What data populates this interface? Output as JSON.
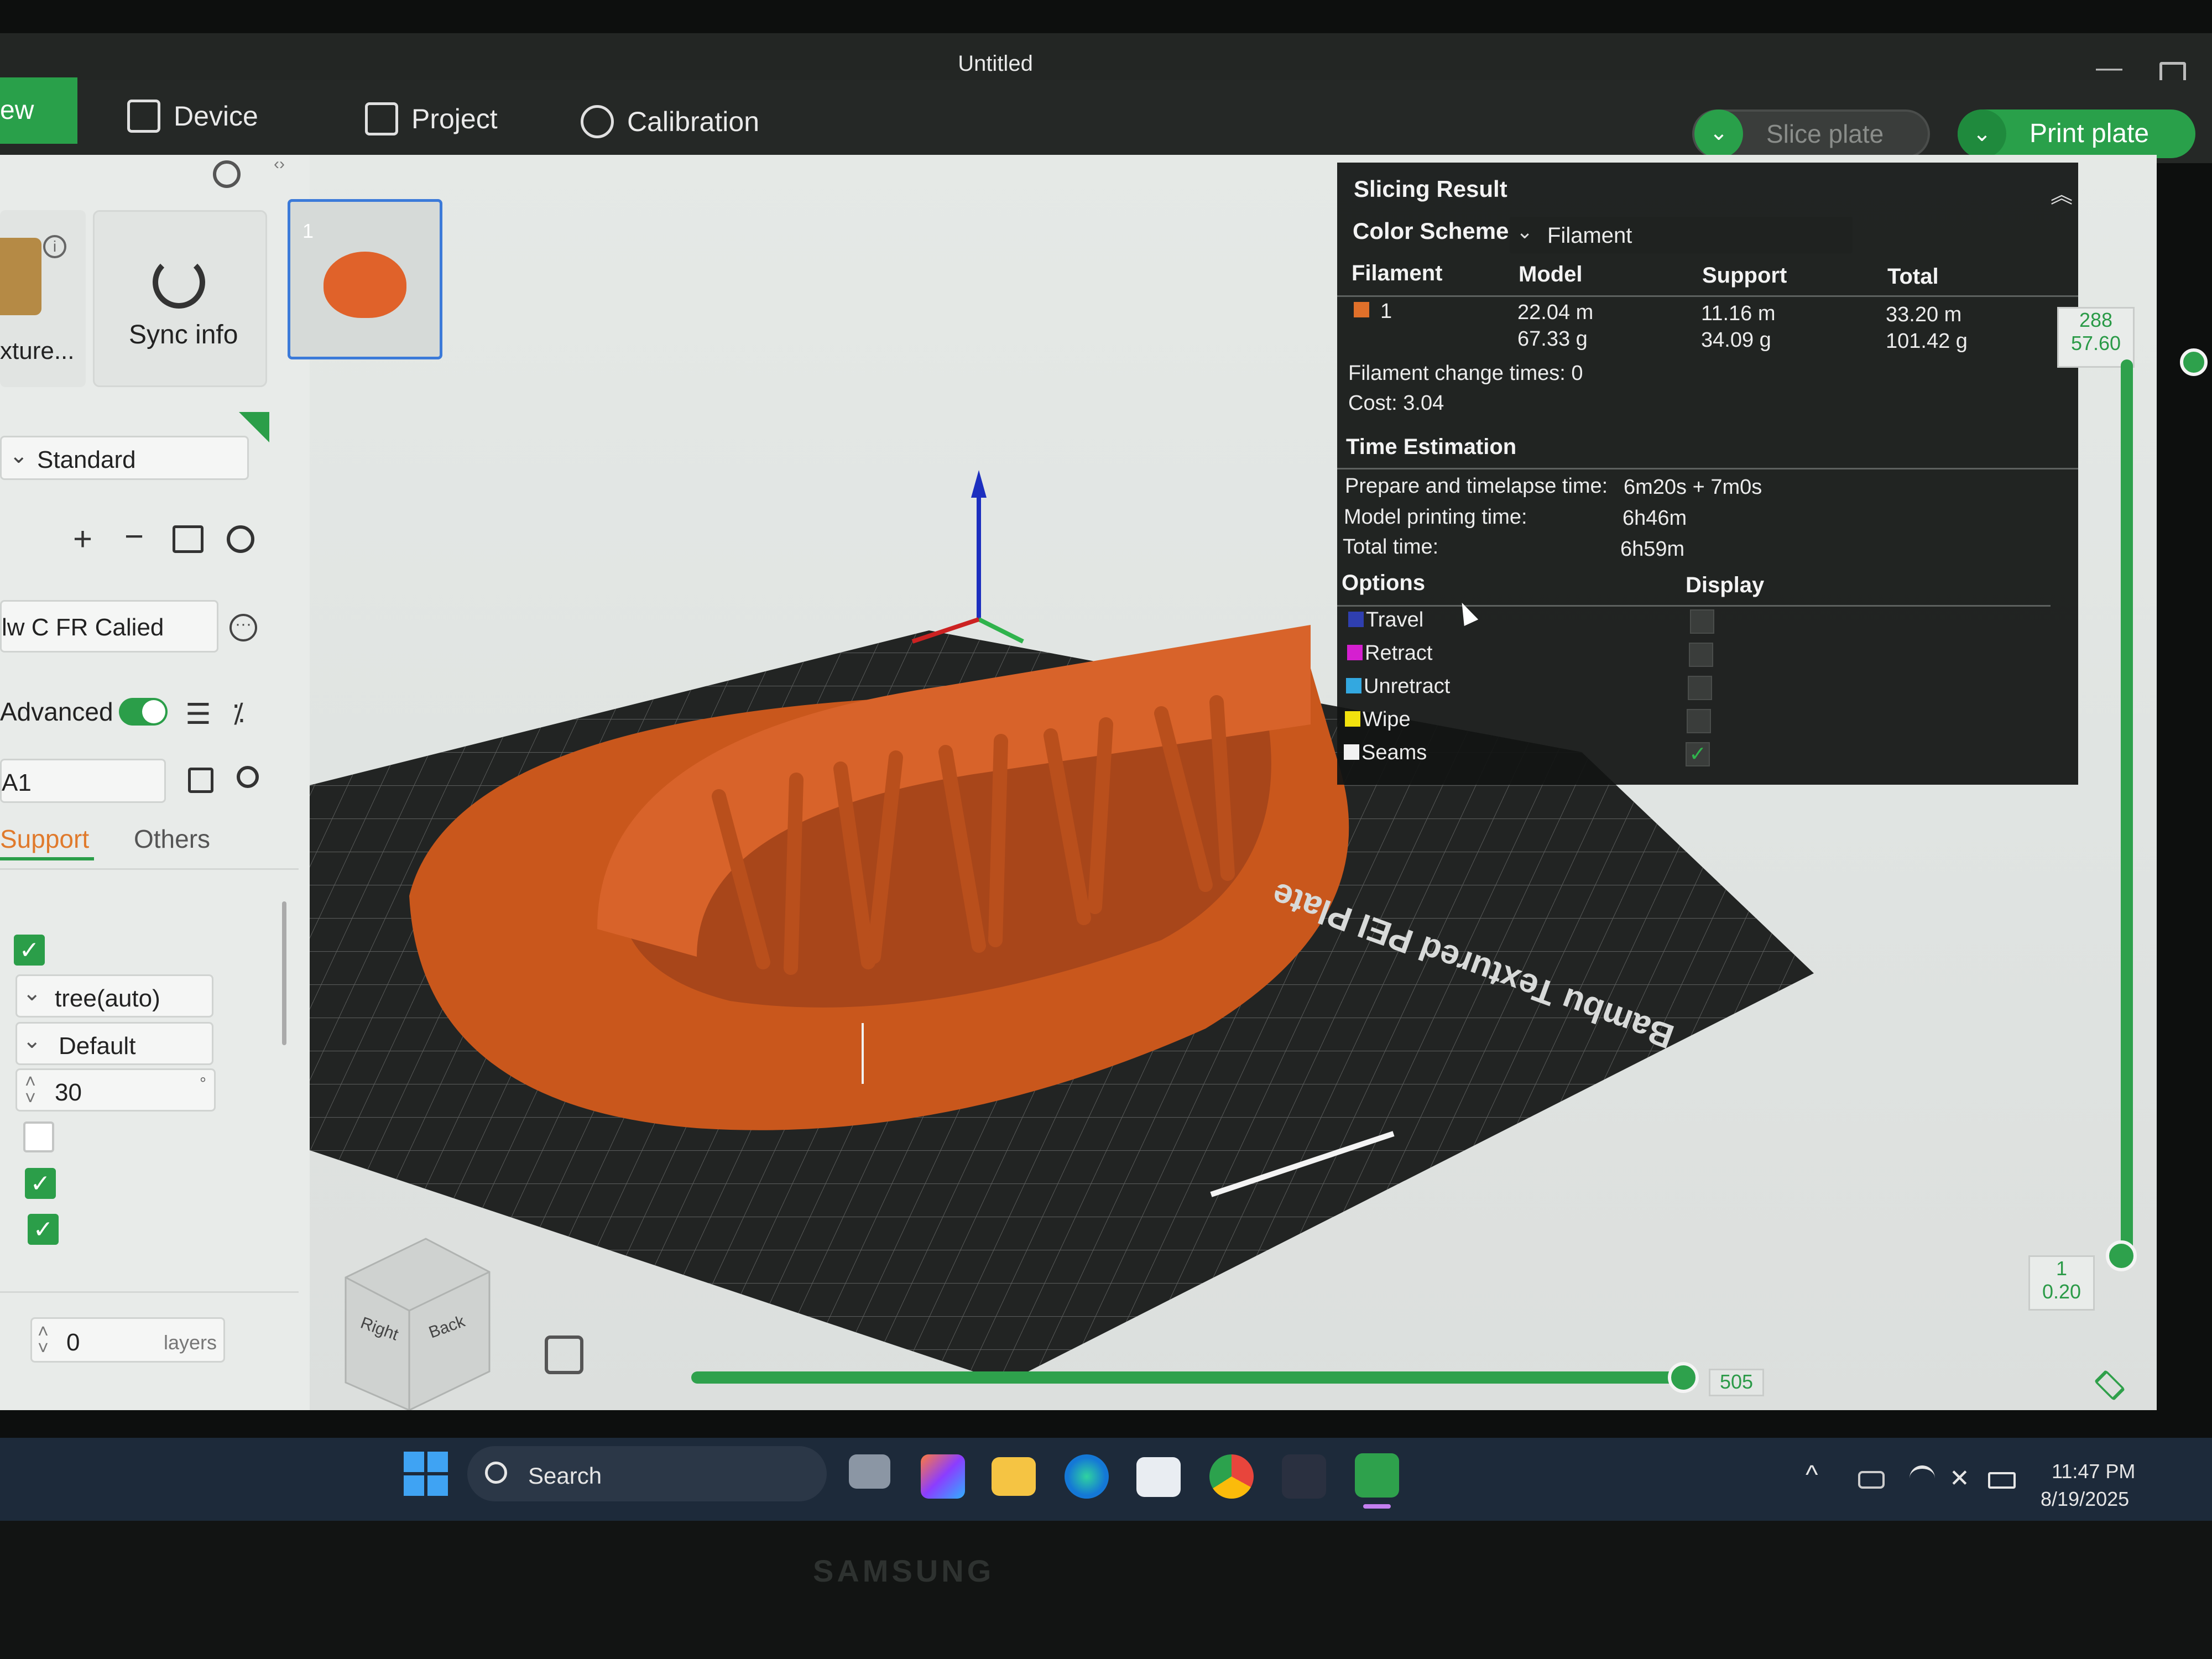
{
  "window": {
    "title": "Untitled"
  },
  "menu": {
    "preview_label": "ew",
    "tabs": [
      {
        "label": "Device",
        "icon": "device-icon"
      },
      {
        "label": "Project",
        "icon": "project-icon"
      },
      {
        "label": "Calibration",
        "icon": "calibration-icon"
      }
    ],
    "slice_label": "Slice plate",
    "print_label": "Print plate"
  },
  "sidebar": {
    "texture_label": "xture...",
    "sync_label": "Sync info",
    "preset": "Standard",
    "filament": "lw C FR Calied",
    "advanced_label": "Advanced",
    "search_value": "A1",
    "tabs": [
      "Support",
      "Others"
    ],
    "support_type": "tree(auto)",
    "support_style": "Default",
    "threshold": "30",
    "threshold_unit": "°",
    "layers_value": "0",
    "layers_unit": "layers"
  },
  "plate": {
    "number": "1",
    "bed_text": "Bambu Textured PEI Plate"
  },
  "view_cube": {
    "right": "Right",
    "back": "Back"
  },
  "slicing": {
    "title": "Slicing Result",
    "color_scheme_label": "Color Scheme",
    "color_scheme_value": "Filament",
    "columns": [
      "Filament",
      "Model",
      "Support",
      "Total"
    ],
    "filament_row": {
      "id": "1",
      "color": "#e0702a",
      "model_len": "22.04 m",
      "model_wt": "67.33 g",
      "support_len": "11.16 m",
      "support_wt": "34.09 g",
      "total_len": "33.20 m",
      "total_wt": "101.42 g"
    },
    "filament_change": "Filament change times:  0",
    "cost": "Cost:  3.04",
    "time_title": "Time Estimation",
    "times": [
      {
        "label": "Prepare and timelapse time:",
        "value": "6m20s + 7m0s"
      },
      {
        "label": "Model printing time:",
        "value": "6h46m"
      },
      {
        "label": "Total time:",
        "value": "6h59m"
      }
    ],
    "options_label": "Options",
    "display_label": "Display",
    "options": [
      {
        "label": "Travel",
        "color": "#2f3fb0",
        "on": false
      },
      {
        "label": "Retract",
        "color": "#d51fd0",
        "on": false
      },
      {
        "label": "Unretract",
        "color": "#33a8e0",
        "on": false
      },
      {
        "label": "Wipe",
        "color": "#f2e20e",
        "on": false
      },
      {
        "label": "Seams",
        "color": "#f2f2f2",
        "on": true
      }
    ]
  },
  "layer_slider": {
    "top_layer": "288",
    "top_height": "57.60",
    "bottom_layer": "1",
    "bottom_height": "0.20"
  },
  "move_slider": {
    "value": "505"
  },
  "taskbar": {
    "search_label": "Search",
    "time": "11:47 PM",
    "date": "8/19/2025"
  },
  "bezel": {
    "brand": "SAMSUNG"
  }
}
